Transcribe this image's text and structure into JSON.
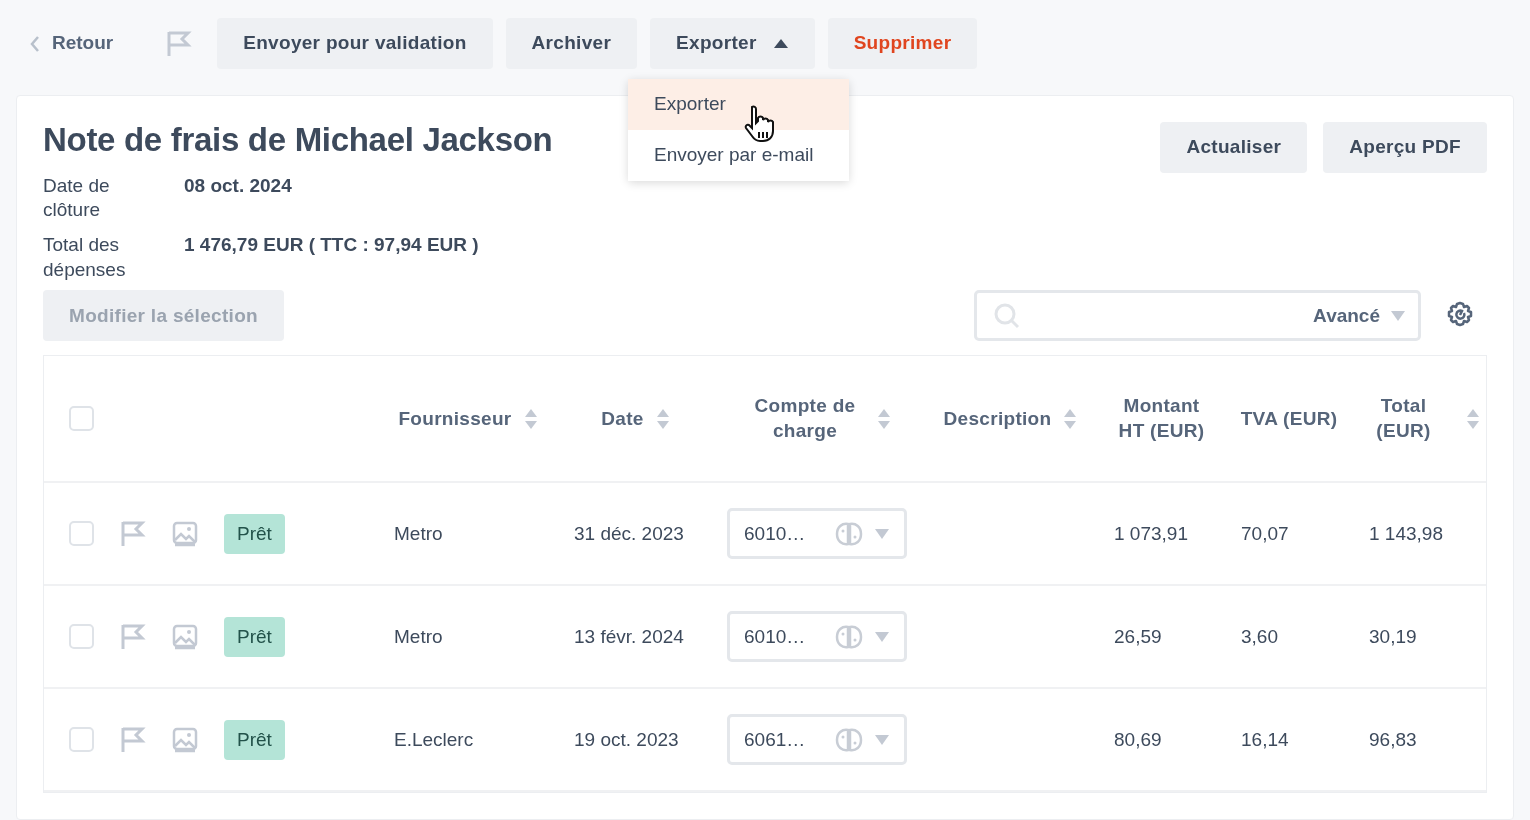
{
  "toolbar": {
    "back": "Retour",
    "flagged": false,
    "buttons": [
      {
        "label": "Envoyer pour validation",
        "kind": "plain"
      },
      {
        "label": "Archiver",
        "kind": "plain"
      },
      {
        "label": "Exporter",
        "kind": "dropdown",
        "expanded": true
      },
      {
        "label": "Supprimer",
        "kind": "danger"
      }
    ]
  },
  "export_menu": {
    "items": [
      {
        "label": "Exporter",
        "selected": true
      },
      {
        "label": "Envoyer par e-mail",
        "selected": false
      }
    ]
  },
  "title": "Note de frais de Michael Jackson",
  "actions": [
    "Actualiser",
    "Aperçu PDF"
  ],
  "fields": [
    {
      "label": "Date de clôture",
      "value": "08 oct. 2024"
    },
    {
      "label": "Total des dépenses",
      "value": "1 476,79 EUR ( TTC : 97,94 EUR )"
    }
  ],
  "edit_selection": {
    "label": "Modifier la sélection",
    "disabled": true
  },
  "search": {
    "advanced": "Avancé"
  },
  "table": {
    "all_checked": false,
    "columns": [
      {
        "label": "Fournisseur",
        "sortable": true
      },
      {
        "label": "Date",
        "sortable": true
      },
      {
        "label": "Compte de charge",
        "sortable": true
      },
      {
        "label": "Description",
        "sortable": true
      },
      {
        "label": "Montant HT (EUR)",
        "sortable": false
      },
      {
        "label": "TVA (EUR)",
        "sortable": false
      },
      {
        "label": "Total (EUR)",
        "sortable": true
      }
    ],
    "rows": [
      {
        "checked": false,
        "flagged": false,
        "status": "Prêt",
        "supplier": "Metro",
        "date": "31 déc. 2023",
        "account": "6010…",
        "amount": "1 073,91",
        "vat": "70,07",
        "total": "1 143,98"
      },
      {
        "checked": false,
        "flagged": false,
        "status": "Prêt",
        "supplier": "Metro",
        "date": "13 févr. 2024",
        "account": "6010…",
        "amount": "26,59",
        "vat": "3,60",
        "total": "30,19"
      },
      {
        "checked": false,
        "flagged": false,
        "status": "Prêt",
        "supplier": "E.Leclerc",
        "date": "19 oct. 2023",
        "account": "6061…",
        "amount": "80,69",
        "vat": "16,14",
        "total": "96,83"
      }
    ]
  }
}
